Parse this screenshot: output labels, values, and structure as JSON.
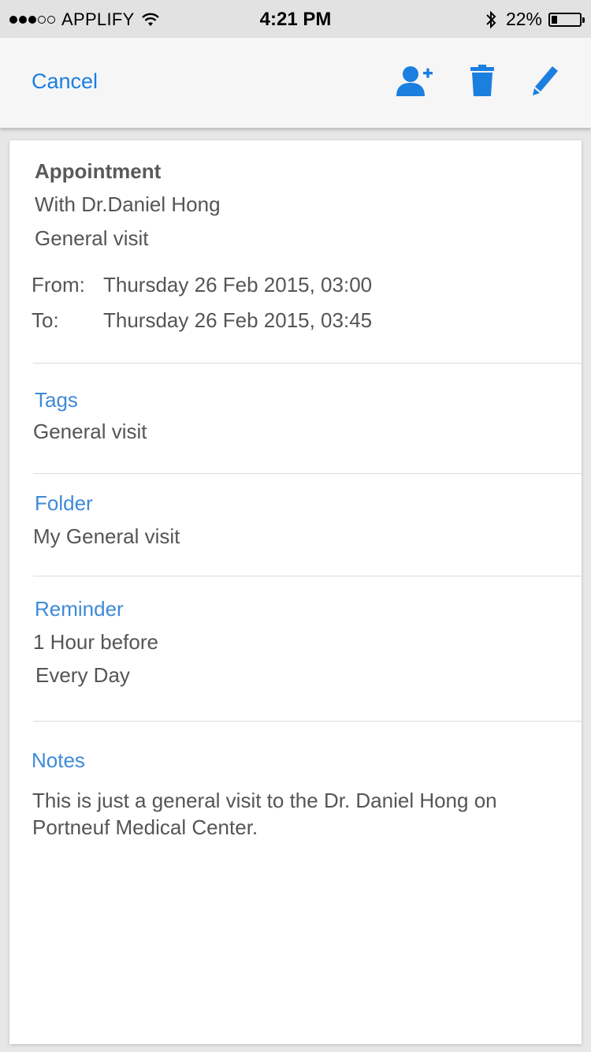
{
  "status_bar": {
    "carrier": "APPLIFY",
    "time": "4:21 PM",
    "battery_percent": "22%",
    "battery_level": 0.22,
    "signal_bars_filled": 3,
    "signal_bars_total": 5,
    "icons": [
      "signal-icon",
      "wifi-icon",
      "bluetooth-icon",
      "battery-icon"
    ]
  },
  "nav": {
    "cancel_label": "Cancel",
    "accent_color": "#1b7fe0",
    "icons": [
      "add-person-icon",
      "trash-icon",
      "pencil-icon"
    ]
  },
  "appointment": {
    "heading": "Appointment",
    "with": "With Dr.Daniel Hong",
    "type": "General visit",
    "from_label": "From:",
    "from_value": "Thursday 26 Feb 2015, 03:00",
    "to_label": "To:",
    "to_value": "Thursday 26 Feb 2015, 03:45"
  },
  "tags": {
    "label": "Tags",
    "value": "General visit"
  },
  "folder": {
    "label": "Folder",
    "value": "My General visit"
  },
  "reminder": {
    "label": "Reminder",
    "time": "1 Hour before",
    "repeat": "Every Day"
  },
  "notes": {
    "label": "Notes",
    "text": "This is just a general visit to the Dr. Daniel Hong on Portneuf Medical Center."
  }
}
